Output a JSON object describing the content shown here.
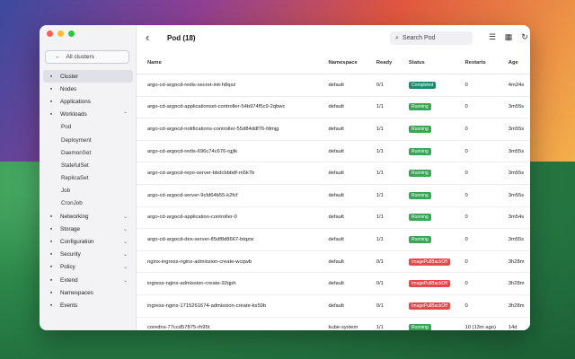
{
  "window": {
    "back_glyph": "‹",
    "title": "Pod (18)",
    "search_placeholder": "Search Pod"
  },
  "sidebar": {
    "all_clusters": "All clusters",
    "items": [
      {
        "label": "Cluster",
        "icon": "cluster-icon",
        "active": true
      },
      {
        "label": "Nodes",
        "icon": "nodes-icon"
      },
      {
        "label": "Applications",
        "icon": "applications-icon"
      },
      {
        "label": "Workloads",
        "icon": "workloads-icon",
        "expanded": true
      },
      {
        "label": "Pod",
        "sub": true
      },
      {
        "label": "Deployment",
        "sub": true
      },
      {
        "label": "DaemonSet",
        "sub": true
      },
      {
        "label": "StatefulSet",
        "sub": true
      },
      {
        "label": "ReplicaSet",
        "sub": true
      },
      {
        "label": "Job",
        "sub": true
      },
      {
        "label": "CronJob",
        "sub": true
      },
      {
        "label": "Networking",
        "icon": "networking-icon",
        "chevron": "down"
      },
      {
        "label": "Storage",
        "icon": "storage-icon",
        "chevron": "down"
      },
      {
        "label": "Configuration",
        "icon": "configuration-icon",
        "chevron": "down"
      },
      {
        "label": "Security",
        "icon": "security-icon",
        "chevron": "down"
      },
      {
        "label": "Policy",
        "icon": "policy-icon",
        "chevron": "down"
      },
      {
        "label": "Extend",
        "icon": "extend-icon",
        "chevron": "down"
      },
      {
        "label": "Namespaces",
        "icon": "namespaces-icon"
      },
      {
        "label": "Events",
        "icon": "events-icon"
      }
    ]
  },
  "table": {
    "headers": {
      "name": "Name",
      "namespace": "Namespace",
      "ready": "Ready",
      "status": "Status",
      "restarts": "Restarts",
      "age": "Age"
    },
    "rows": [
      {
        "name": "argo-cd-argocd-redis-secret-init-h8qsz",
        "namespace": "default",
        "ready": "0/1",
        "status": "Completed",
        "kind": "completed",
        "restarts": "0",
        "age": "4m24s"
      },
      {
        "name": "argo-cd-argocd-applicationset-controller-54b974f5c9-2qbwc",
        "namespace": "default",
        "ready": "1/1",
        "status": "Running",
        "kind": "running",
        "restarts": "0",
        "age": "3m55s"
      },
      {
        "name": "argo-cd-argocd-notifications-controller-55d84ddf76-fdmjg",
        "namespace": "default",
        "ready": "1/1",
        "status": "Running",
        "kind": "running",
        "restarts": "0",
        "age": "3m55s"
      },
      {
        "name": "argo-cd-argocd-redis-696c74c676-rgjtk",
        "namespace": "default",
        "ready": "1/1",
        "status": "Running",
        "kind": "running",
        "restarts": "0",
        "age": "3m55s"
      },
      {
        "name": "argo-cd-argocd-repo-server-bbdcbbbdf-m5k7b",
        "namespace": "default",
        "ready": "1/1",
        "status": "Running",
        "kind": "running",
        "restarts": "0",
        "age": "3m55s"
      },
      {
        "name": "argo-cd-argocd-server-9cfd64b55-k2fcf",
        "namespace": "default",
        "ready": "1/1",
        "status": "Running",
        "kind": "running",
        "restarts": "0",
        "age": "3m55s"
      },
      {
        "name": "argo-cd-argocd-application-controller-0",
        "namespace": "default",
        "ready": "1/1",
        "status": "Running",
        "kind": "running",
        "restarts": "0",
        "age": "3m54s"
      },
      {
        "name": "argo-cd-argocd-dex-server-85df8d8667-btqzw",
        "namespace": "default",
        "ready": "1/1",
        "status": "Running",
        "kind": "running",
        "restarts": "0",
        "age": "3m55s"
      },
      {
        "name": "nginx-ingress-nginx-admission-create-wcqwb",
        "namespace": "default",
        "ready": "0/1",
        "status": "ImagePullBackOff",
        "kind": "error",
        "restarts": "0",
        "age": "3h28m"
      },
      {
        "name": "ingress-nginx-admission-create-92qph",
        "namespace": "default",
        "ready": "0/1",
        "status": "ImagePullBackOff",
        "kind": "error",
        "restarts": "0",
        "age": "3h28m"
      },
      {
        "name": "ingress-nginx-1715261674-admission-create-ks59b",
        "namespace": "default",
        "ready": "0/1",
        "status": "ImagePullBackOff",
        "kind": "error",
        "restarts": "0",
        "age": "3h28m"
      },
      {
        "name": "coredns-77ccd57875-rh95t",
        "namespace": "kube-system",
        "ready": "1/1",
        "status": "Running",
        "kind": "running",
        "restarts": "10 (13m ago)",
        "age": "14d"
      }
    ]
  }
}
